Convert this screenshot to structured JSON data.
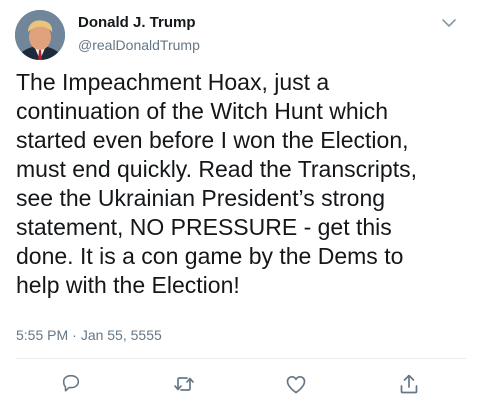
{
  "tweet": {
    "author": {
      "name": "Donald J. Trump",
      "handle": "@realDonaldTrump"
    },
    "text": "The Impeachment Hoax, just a\ncontinuation of the Witch Hunt which\nstarted even before I won the Election,\nmust end quickly. Read the Transcripts,\nsee the Ukrainian President’s strong\nstatement, NO PRESSURE - get this\ndone. It is a con game by the Dems to\nhelp with the Election!",
    "time": "5:55 PM",
    "separator": "·",
    "date": "Jan 55, 5555"
  },
  "icons": {
    "menu": "chevron-down-icon",
    "reply": "reply-icon",
    "retweet": "retweet-icon",
    "like": "like-icon",
    "share": "share-icon"
  },
  "colors": {
    "text": "#14171a",
    "secondary": "#657786",
    "divider": "#e6ecf0"
  }
}
